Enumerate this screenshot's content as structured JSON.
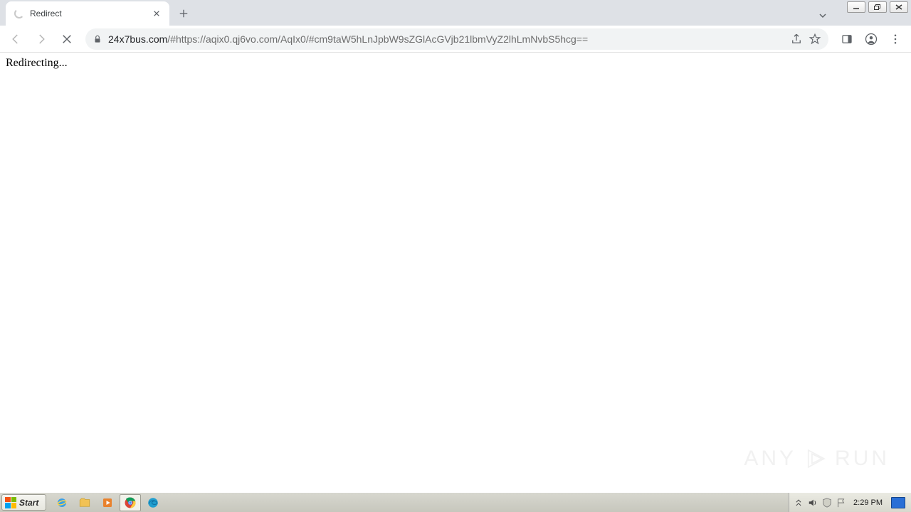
{
  "window": {
    "minimize_label": "Minimize",
    "maximize_label": "Restore",
    "close_label": "Close"
  },
  "tab": {
    "title": "Redirect",
    "close_label": "Close tab"
  },
  "tabstrip": {
    "new_tab_label": "New tab",
    "overflow_label": "Search tabs"
  },
  "toolbar": {
    "back_label": "Back",
    "forward_label": "Forward",
    "stop_label": "Stop loading",
    "url_host": "24x7bus.com",
    "url_rest": "/#https://aqix0.qj6vo.com/AqIx0/#cm9taW5hLnJpbW9sZGlAcGVjb21lbmVyZ2lhLmNvbS5hcg==",
    "share_label": "Share",
    "bookmark_label": "Bookmark",
    "sidepanel_label": "Side panel",
    "profile_label": "Profile",
    "menu_label": "Menu"
  },
  "page": {
    "body_text": "Redirecting..."
  },
  "watermark": {
    "left": "ANY",
    "right": "RUN"
  },
  "taskbar": {
    "start_label": "Start",
    "clock": "2:29 PM",
    "ie_label": "Internet Explorer",
    "explorer_label": "File Explorer",
    "media_label": "Media Player",
    "chrome_label": "Google Chrome",
    "edge_label": "Microsoft Edge",
    "tray_expand_label": "Show hidden icons",
    "tray_volume_label": "Volume",
    "tray_security_label": "Security",
    "tray_flag_label": "Action Center",
    "tray_desktop_label": "Show desktop"
  }
}
